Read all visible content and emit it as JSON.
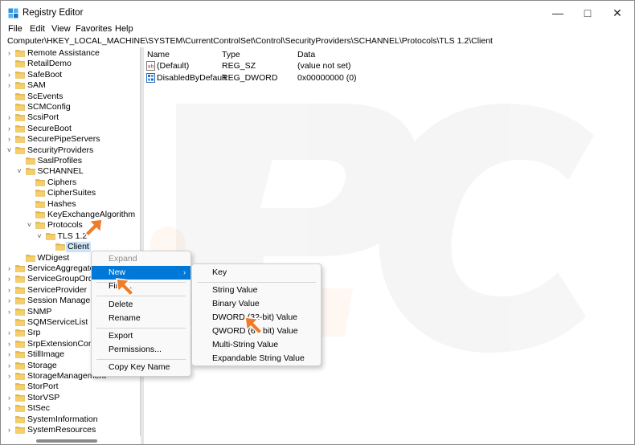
{
  "window": {
    "title": "Registry Editor",
    "min": "—",
    "max": "□",
    "close": "✕"
  },
  "menu": [
    "File",
    "Edit",
    "View",
    "Favorites",
    "Help"
  ],
  "address": "Computer\\HKEY_LOCAL_MACHINE\\SYSTEM\\CurrentControlSet\\Control\\SecurityProviders\\SCHANNEL\\Protocols\\TLS 1.2\\Client",
  "tree": [
    {
      "label": "Remote Assistance",
      "chev": ">"
    },
    {
      "label": "RetailDemo",
      "chev": ""
    },
    {
      "label": "SafeBoot",
      "chev": ">"
    },
    {
      "label": "SAM",
      "chev": ">"
    },
    {
      "label": "ScEvents",
      "chev": ""
    },
    {
      "label": "SCMConfig",
      "chev": ""
    },
    {
      "label": "ScsiPort",
      "chev": ">"
    },
    {
      "label": "SecureBoot",
      "chev": ">"
    },
    {
      "label": "SecurePipeServers",
      "chev": ">"
    },
    {
      "label": "SecurityProviders",
      "chev": "v"
    },
    {
      "label": "SaslProfiles",
      "chev": ""
    },
    {
      "label": "SCHANNEL",
      "chev": "v"
    },
    {
      "label": "Ciphers",
      "chev": ""
    },
    {
      "label": "CipherSuites",
      "chev": ""
    },
    {
      "label": "Hashes",
      "chev": ""
    },
    {
      "label": "KeyExchangeAlgorithm",
      "chev": ""
    },
    {
      "label": "Protocols",
      "chev": "v"
    },
    {
      "label": "TLS 1.2",
      "chev": "v"
    },
    {
      "label": "Client",
      "chev": ""
    },
    {
      "label": "WDigest",
      "chev": ""
    },
    {
      "label": "ServiceAggregatedEvents",
      "chev": ">"
    },
    {
      "label": "ServiceGroupOrder",
      "chev": ">"
    },
    {
      "label": "ServiceProvider",
      "chev": ">"
    },
    {
      "label": "Session Manager",
      "chev": ">"
    },
    {
      "label": "SNMP",
      "chev": ">"
    },
    {
      "label": "SQMServiceList",
      "chev": ""
    },
    {
      "label": "Srp",
      "chev": ">"
    },
    {
      "label": "SrpExtensionConfig",
      "chev": ">"
    },
    {
      "label": "StillImage",
      "chev": ">"
    },
    {
      "label": "Storage",
      "chev": ">"
    },
    {
      "label": "StorageManagement",
      "chev": ">"
    },
    {
      "label": "StorPort",
      "chev": ""
    },
    {
      "label": "StorVSP",
      "chev": ">"
    },
    {
      "label": "StSec",
      "chev": ">"
    },
    {
      "label": "SystemInformation",
      "chev": ""
    },
    {
      "label": "SystemResources",
      "chev": ">"
    }
  ],
  "list": {
    "columns": [
      "Name",
      "Type",
      "Data"
    ],
    "rows": [
      {
        "name": "(Default)",
        "type": "REG_SZ",
        "data": "(value not set)",
        "icon": "string-value-icon"
      },
      {
        "name": "DisabledByDefault",
        "type": "REG_DWORD",
        "data": "0x00000000 (0)",
        "icon": "binary-value-icon"
      }
    ]
  },
  "context_menu": {
    "items": [
      "Expand",
      "New",
      "Find...",
      "Delete",
      "Rename",
      "Export",
      "Permissions...",
      "Copy Key Name"
    ]
  },
  "submenu": {
    "items": [
      "Key",
      "String Value",
      "Binary Value",
      "DWORD (32-bit) Value",
      "QWORD (64-bit) Value",
      "Multi-String Value",
      "Expandable String Value"
    ]
  },
  "colors": {
    "highlight": "#0078d7",
    "selection": "#cce4f7",
    "folder": "#e8b84a",
    "cursor": "#f07c2a"
  }
}
